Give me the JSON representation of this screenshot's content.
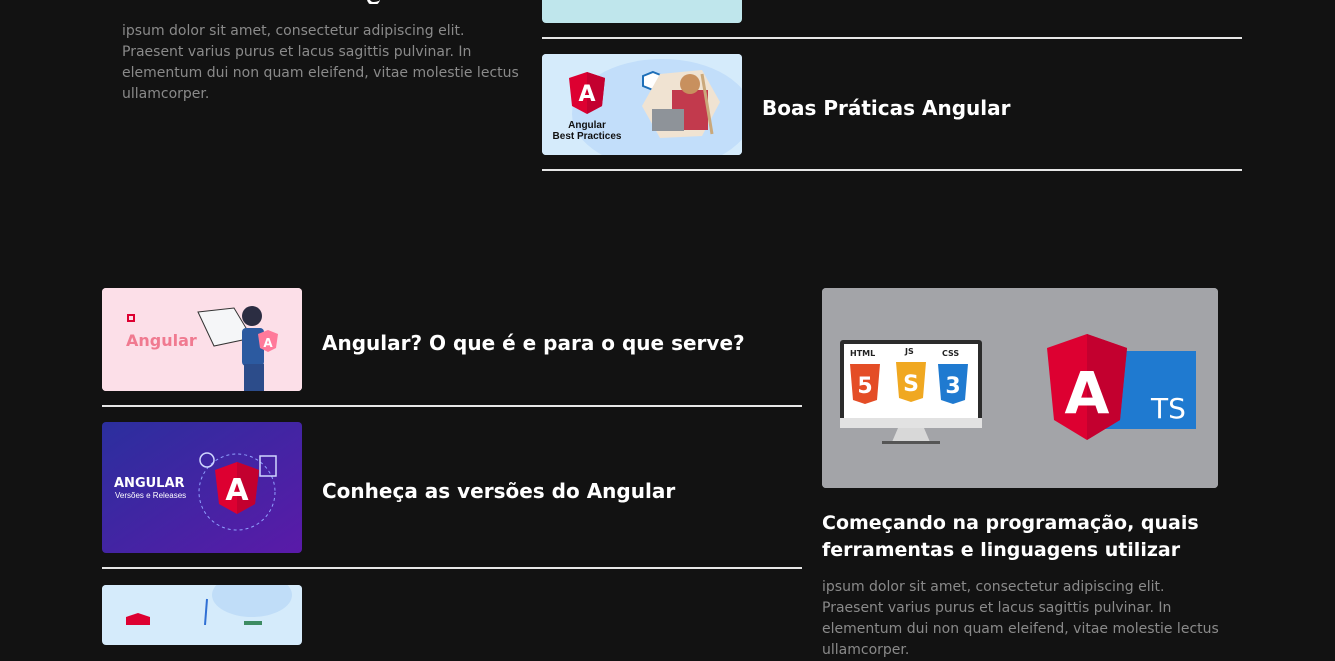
{
  "top_section": {
    "left_excerpt": "ipsum dolor sit amet, consectetur adipiscing elit. Praesent varius purus et lacus sagittis pulvinar. In elementum dui non quam eleifend, vitae molestie lectus ullamcorper.",
    "right_card": {
      "title": "Boas Práticas Angular",
      "thumb_line1": "Angular",
      "thumb_line2": "Best Practices"
    }
  },
  "bottom_section": {
    "list": [
      {
        "title": "Angular? O que é e para o que serve?",
        "thumb_text": "Angular"
      },
      {
        "title": "Conheça as versões do Angular",
        "thumb_line1": "ANGULAR",
        "thumb_line2": "Versões e Releases"
      }
    ],
    "featured": {
      "title": "Começando na programação, quais ferramentas e linguagens utilizar",
      "excerpt": "ipsum dolor sit amet, consectetur adipiscing elit. Praesent varius purus et lacus sagittis pulvinar. In elementum dui non quam eleifend, vitae molestie lectus ullamcorper.",
      "icons": {
        "html": "HTML",
        "js": "JS",
        "css": "CSS",
        "ts": "TS"
      }
    }
  },
  "colors": {
    "background": "#121212",
    "angular_red": "#dd0031",
    "angular_dark_red": "#c3002f",
    "ts_blue": "#1f7ad0"
  }
}
